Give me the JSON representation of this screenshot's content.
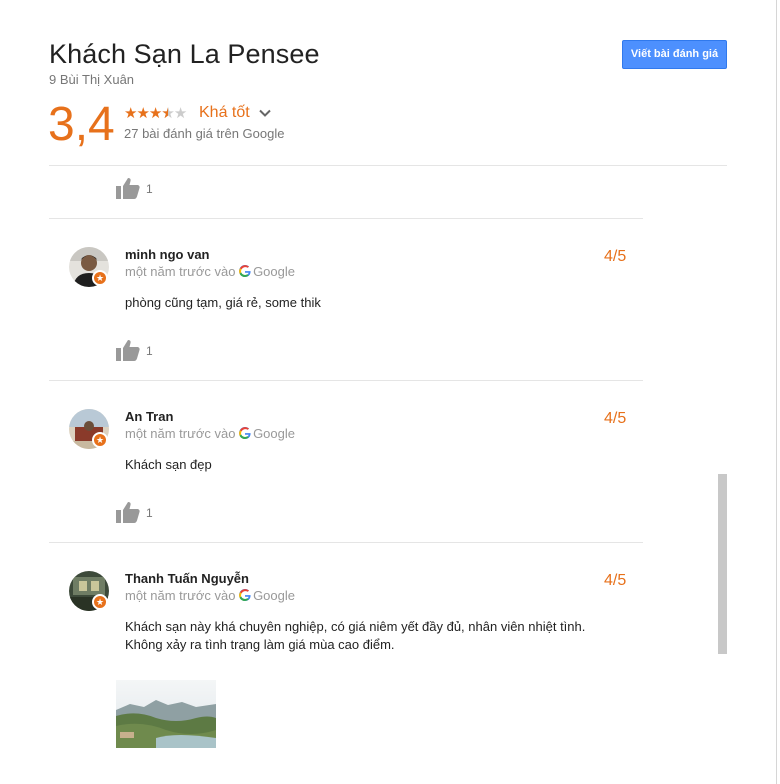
{
  "hotel": {
    "name": "Khách Sạn La Pensee",
    "address": "9 Bùi Thị Xuân",
    "write_review_label": "Viết bài đánh giá"
  },
  "rating": {
    "score": "3,4",
    "stars_value": 3.4,
    "stars_max": 5,
    "label": "Khá tốt",
    "review_count_text": "27 bài đánh giá trên Google"
  },
  "previous_review": {
    "likes": "1"
  },
  "reviews": [
    {
      "name": "minh ngo van",
      "time": "một năm trước vào",
      "source": "Google",
      "score": "4/5",
      "text": "phòng cũng tạm, giá rẻ, some thik",
      "likes": "1"
    },
    {
      "name": "An Tran",
      "time": "một năm trước vào",
      "source": "Google",
      "score": "4/5",
      "text": "Khách sạn đẹp",
      "likes": "1"
    },
    {
      "name": "Thanh Tuấn Nguyễn",
      "time": "một năm trước vào",
      "source": "Google",
      "score": "4/5",
      "text_line1": "Khách sạn này khá chuyên nghiệp, có giá niêm yết đầy đủ, nhân viên nhiệt tình.",
      "text_line2": "Không xảy ra tình trạng làm giá mùa cao điểm."
    }
  ],
  "icons": {
    "thumb": "thumbs-up-icon",
    "badge": "local-guide-star-icon",
    "chevron": "chevron-down-icon",
    "google": "google-g-icon"
  },
  "colors": {
    "accent": "#e7711b",
    "button": "#4d90fe"
  }
}
